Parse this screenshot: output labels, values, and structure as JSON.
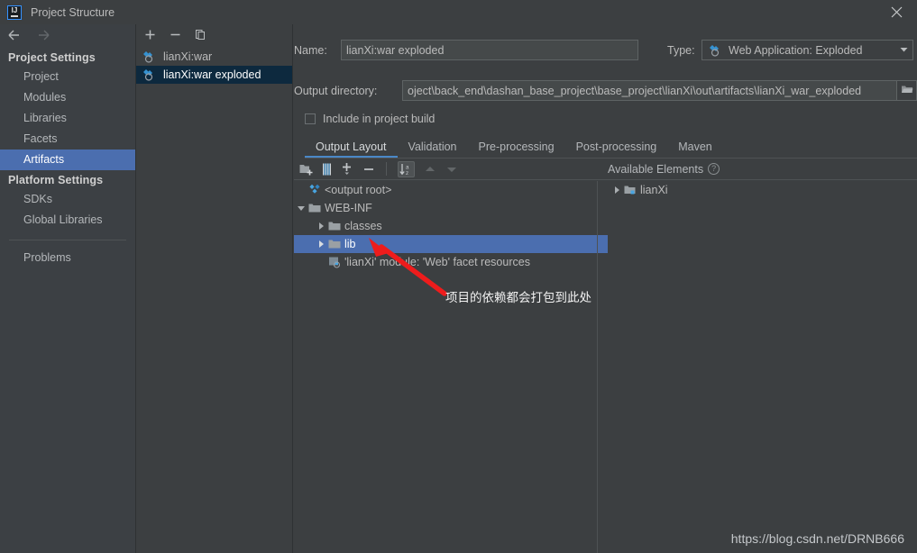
{
  "window": {
    "title": "Project Structure",
    "app_icon": "intellij-idea-icon",
    "close_icon": "close-icon"
  },
  "nav": {
    "back_icon": "arrow-left-icon",
    "forward_icon": "arrow-right-icon"
  },
  "sidebar": {
    "groups": [
      {
        "label": "Project Settings",
        "items": [
          {
            "label": "Project",
            "selected": false
          },
          {
            "label": "Modules",
            "selected": false
          },
          {
            "label": "Libraries",
            "selected": false
          },
          {
            "label": "Facets",
            "selected": false
          },
          {
            "label": "Artifacts",
            "selected": true
          }
        ]
      },
      {
        "label": "Platform Settings",
        "items": [
          {
            "label": "SDKs",
            "selected": false
          },
          {
            "label": "Global Libraries",
            "selected": false
          }
        ]
      }
    ],
    "extra": [
      {
        "label": "Problems",
        "selected": false
      }
    ]
  },
  "artifacts": {
    "toolbar": [
      {
        "name": "add-artifact-button",
        "icon": "plus-icon"
      },
      {
        "name": "remove-artifact-button",
        "icon": "minus-icon"
      },
      {
        "name": "copy-artifact-button",
        "icon": "copy-icon"
      }
    ],
    "items": [
      {
        "label": "lianXi:war",
        "icon": "artifact-icon",
        "selected": false
      },
      {
        "label": "lianXi:war exploded",
        "icon": "artifact-icon",
        "selected": true
      }
    ]
  },
  "form": {
    "name_label": "Name:",
    "name_value": "lianXi:war exploded",
    "type_label": "Type:",
    "type_value": "Web Application: Exploded",
    "type_icon": "artifact-icon",
    "type_caret": "chevron-down-icon",
    "output_label": "Output directory:",
    "output_value": "oject\\back_end\\dashan_base_project\\base_project\\lianXi\\out\\artifacts\\lianXi_war_exploded",
    "browse_icon": "folder-open-icon",
    "include_label": "Include in project build",
    "include_checked": false
  },
  "tabs": [
    {
      "label": "Output Layout",
      "active": true
    },
    {
      "label": "Validation",
      "active": false
    },
    {
      "label": "Pre-processing",
      "active": false
    },
    {
      "label": "Post-processing",
      "active": false
    },
    {
      "label": "Maven",
      "active": false
    }
  ],
  "layout_toolbar": [
    {
      "name": "create-directory-button",
      "icon": "new-folder-icon",
      "state": "normal"
    },
    {
      "name": "create-archive-button",
      "icon": "archive-icon",
      "state": "normal"
    },
    {
      "name": "add-copy-of-button",
      "icon": "plus-dropdown-icon",
      "state": "normal"
    },
    {
      "name": "remove-element-button",
      "icon": "minus-icon",
      "state": "normal"
    },
    {
      "name": "sort-elements-button",
      "icon": "sort-az-icon",
      "state": "toggled"
    },
    {
      "name": "move-up-button",
      "icon": "arrow-up-icon",
      "state": "disabled"
    },
    {
      "name": "move-down-button",
      "icon": "arrow-down-icon",
      "state": "disabled"
    }
  ],
  "output_tree": [
    {
      "label": "<output root>",
      "icon": "artifact-root-icon",
      "indent": 0,
      "twisty": "none",
      "selected": false
    },
    {
      "label": "WEB-INF",
      "icon": "folder-icon",
      "indent": 0,
      "twisty": "expanded",
      "selected": false
    },
    {
      "label": "classes",
      "icon": "folder-icon",
      "indent": 1,
      "twisty": "collapsed",
      "selected": false
    },
    {
      "label": "lib",
      "icon": "folder-icon",
      "indent": 1,
      "twisty": "collapsed",
      "selected": true
    },
    {
      "label": "'lianXi' module: 'Web' facet resources",
      "icon": "facet-resources-icon",
      "indent": 1,
      "twisty": "none",
      "selected": false
    }
  ],
  "available": {
    "header": "Available Elements",
    "help_icon": "help-icon",
    "help_glyph": "?",
    "items": [
      {
        "label": "lianXi",
        "icon": "module-icon",
        "twisty": "collapsed"
      }
    ]
  },
  "annotation": {
    "text": "项目的依赖都会打包到此处",
    "arrow_color": "#ee1c1c",
    "arrow_name": "red-annotation-arrow"
  },
  "watermark": "https://blog.csdn.net/DRNB666",
  "colors": {
    "accent_selection": "#4b6eaf",
    "panel_bg": "#3c3f41",
    "sidebar_bg": "#3c4044",
    "tab_underline": "#4a88c7",
    "list_selection": "#0d293e",
    "text": "#bbbbbb"
  }
}
